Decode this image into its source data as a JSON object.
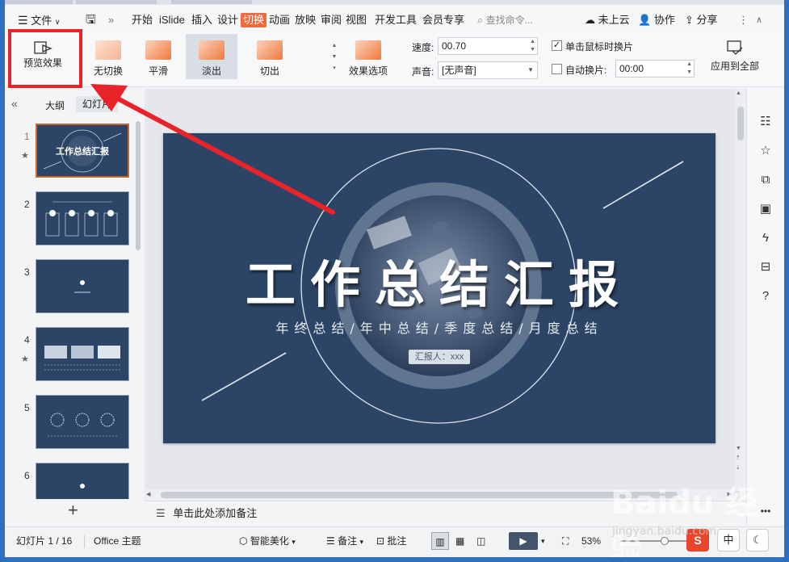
{
  "menubar": {
    "file": "文件",
    "tabs": [
      "开始",
      "iSlide",
      "插入",
      "设计",
      "切换",
      "动画",
      "放映",
      "审阅",
      "视图",
      "开发工具",
      "会员专享"
    ],
    "active_tab": "切换",
    "search_placeholder": "查找命令...",
    "cloud": "未上云",
    "collab": "协作",
    "share": "分享"
  },
  "ribbon": {
    "preview": "预览效果",
    "transitions": [
      "无切换",
      "平滑",
      "淡出",
      "切出"
    ],
    "selected_transition": "淡出",
    "effect_options": "效果选项",
    "speed_label": "速度:",
    "speed_value": "00.70",
    "sound_label": "声音:",
    "sound_value": "[无声音]",
    "on_click_label": "单击鼠标时换片",
    "on_click_checked": true,
    "auto_label": "自动换片:",
    "auto_checked": false,
    "auto_value": "00:00",
    "apply_all": "应用到全部"
  },
  "left_panel": {
    "outline_tab": "大纲",
    "slides_tab": "幻灯片",
    "slide_numbers": [
      "1",
      "2",
      "3",
      "4",
      "5",
      "6"
    ],
    "add_slide": "+"
  },
  "slide": {
    "title": "工作总结汇报",
    "subtitle": "年终总结/年中总结/季度总结/月度总结",
    "reporter": "汇报人：xxx"
  },
  "notes": {
    "placeholder": "单击此处添加备注"
  },
  "statusbar": {
    "slide_count": "幻灯片 1 / 16",
    "theme": "Office 主题",
    "beautify": "智能美化",
    "notes": "备注",
    "comments": "批注",
    "zoom": "53%",
    "ime": "中"
  },
  "watermark": {
    "brand": "Baidu 经验",
    "url": "jingyan.baidu.com"
  },
  "colors": {
    "accent": "#f06a3b",
    "slide_bg": "#2c4566",
    "highlight": "#e8232a"
  }
}
